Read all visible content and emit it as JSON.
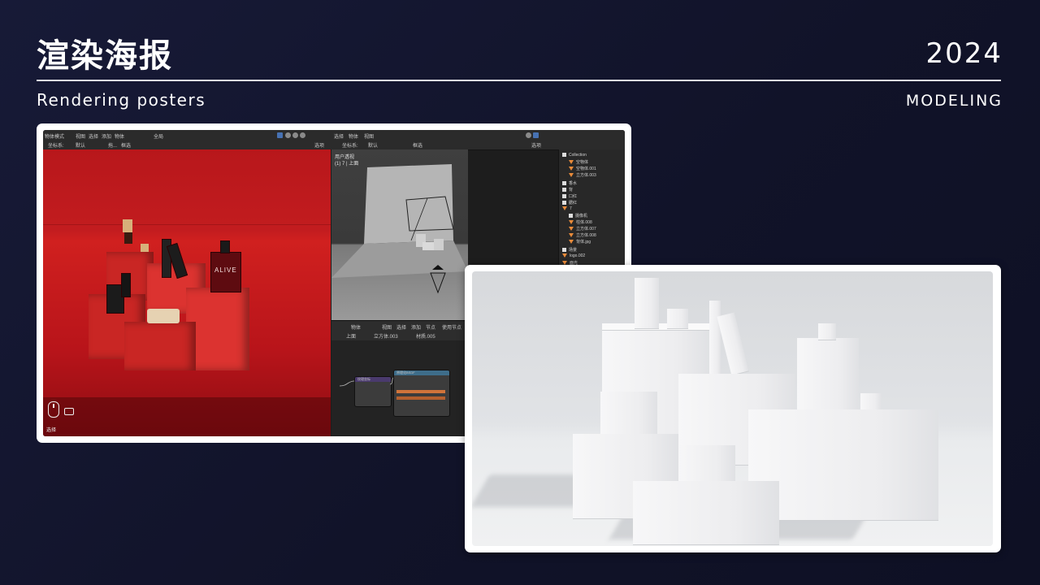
{
  "header": {
    "title_cn": "渲染海报",
    "year": "2024",
    "subtitle": "Rendering posters",
    "tag": "MODELING"
  },
  "blender": {
    "left_toolbar": [
      "物体模式",
      "视图",
      "选择",
      "添加",
      "物体",
      "全局"
    ],
    "left_subbar": [
      "坐标系:",
      "默认",
      "拖...",
      "框选",
      "选项"
    ],
    "right_toolbar": [
      "选择",
      "物体",
      "视图"
    ],
    "right_subbar": [
      "坐标系:",
      "默认",
      "框选",
      "选项"
    ],
    "viewport_hud": [
      "用户透视",
      "(1) 7 | 上面"
    ],
    "bottle_label": "ALIVE",
    "status_select": "选择",
    "node_toolbar": [
      "物体",
      "视图",
      "选择",
      "添加",
      "节点",
      "使用节点"
    ],
    "node_breadcrumb": [
      "上面",
      "立方体.003",
      "材质.005"
    ],
    "node_titles": [
      "纹理坐标",
      "原理化BSDF"
    ],
    "outliner": [
      "Collection",
      "空物体",
      "空物体.001",
      "立方体.003",
      "香水",
      "背",
      "口红",
      "腮红",
      "7",
      "摄像机",
      "柱体.008",
      "立方体.007",
      "立方体.008",
      "背体.jpg",
      "场景",
      "logo.002",
      "面光"
    ]
  },
  "colors": {
    "accent_line": "#e8e8ee",
    "blender_blue": "#4772b3",
    "scene_red": "#c21c1f"
  }
}
